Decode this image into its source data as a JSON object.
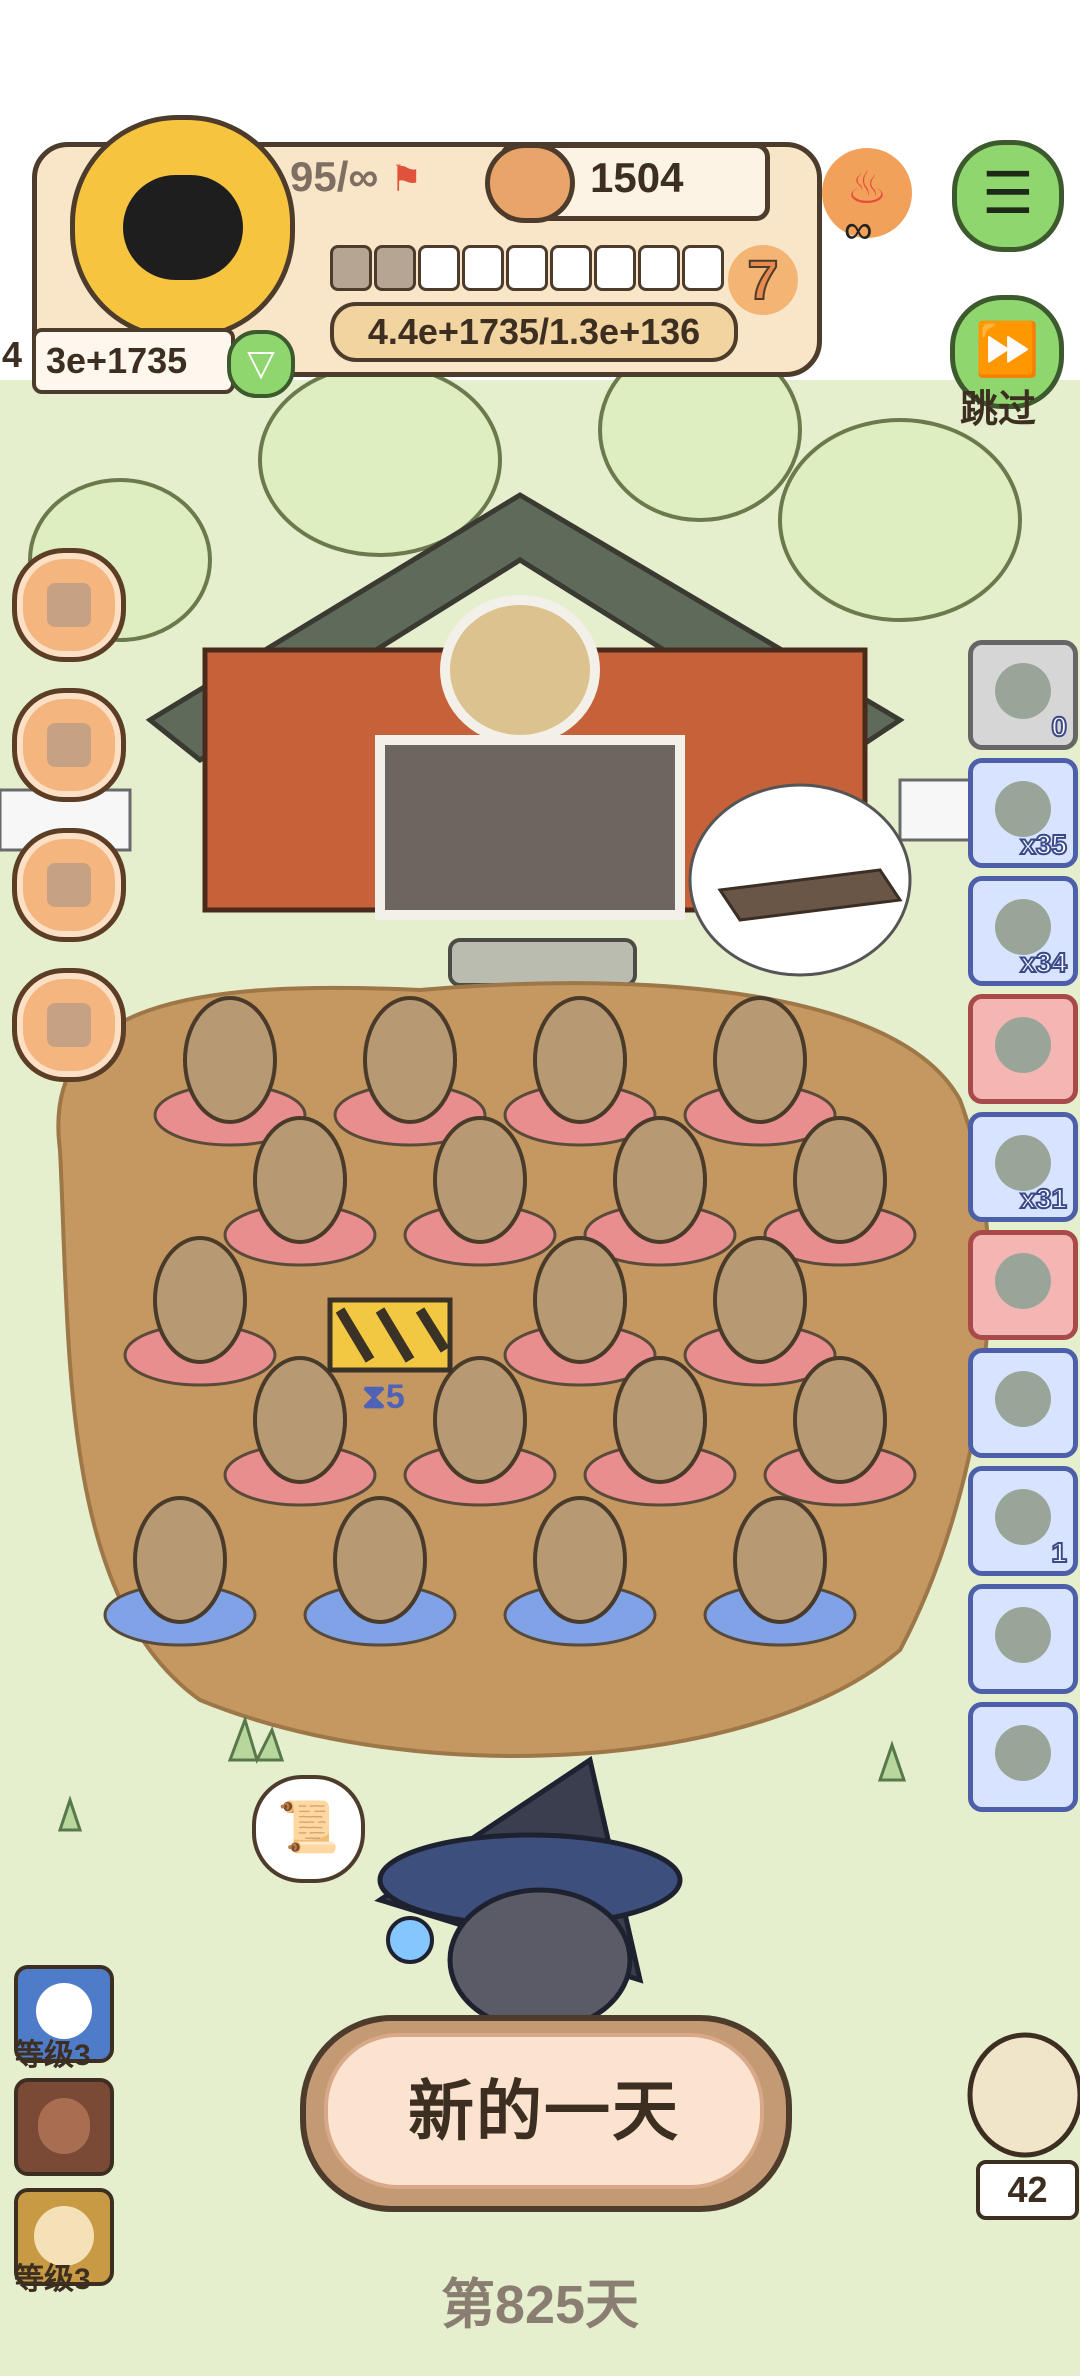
{
  "hud": {
    "energy_text": "95/∞",
    "coin_text": "1504",
    "level_number": "7",
    "progress_text": "4.4e+1735/1.3e+136",
    "wealth_prefix": "4",
    "wealth_text": "3e+1735",
    "progress_pips_filled": 2,
    "progress_pips_total": 9
  },
  "buttons": {
    "skip_label": "跳过",
    "new_day_label": "新的一天"
  },
  "side_items": [
    {
      "icon": "rock-bundle-icon",
      "count": "0"
    },
    {
      "icon": "goggles-icon",
      "count": "x35"
    },
    {
      "icon": "seed-bag-icon",
      "count": "x34"
    },
    {
      "icon": "bell-icon",
      "count": ""
    },
    {
      "icon": "ring-band-icon",
      "count": "x31"
    },
    {
      "icon": "green-orb-icon",
      "count": ""
    },
    {
      "icon": "hut-icon",
      "count": ""
    },
    {
      "icon": "npc-hourglass-icon",
      "count": "1"
    },
    {
      "icon": "feather-icon",
      "count": ""
    },
    {
      "icon": "card-icon",
      "count": ""
    }
  ],
  "left_menu": [
    {
      "icon": "box-icon"
    },
    {
      "icon": "joystick-icon"
    },
    {
      "icon": "gameboy-icon"
    },
    {
      "icon": "fish-icon"
    }
  ],
  "bottom_left": {
    "level_label_1": "等级3",
    "level_label_2": "等级3"
  },
  "blocked_timer": "5",
  "owl_count": "42",
  "day_label": "第825天",
  "colors": {
    "panel": "#f9e6c9",
    "outline": "#4d3b2c",
    "accent_green": "#8fd66e",
    "orange": "#e8894d"
  }
}
